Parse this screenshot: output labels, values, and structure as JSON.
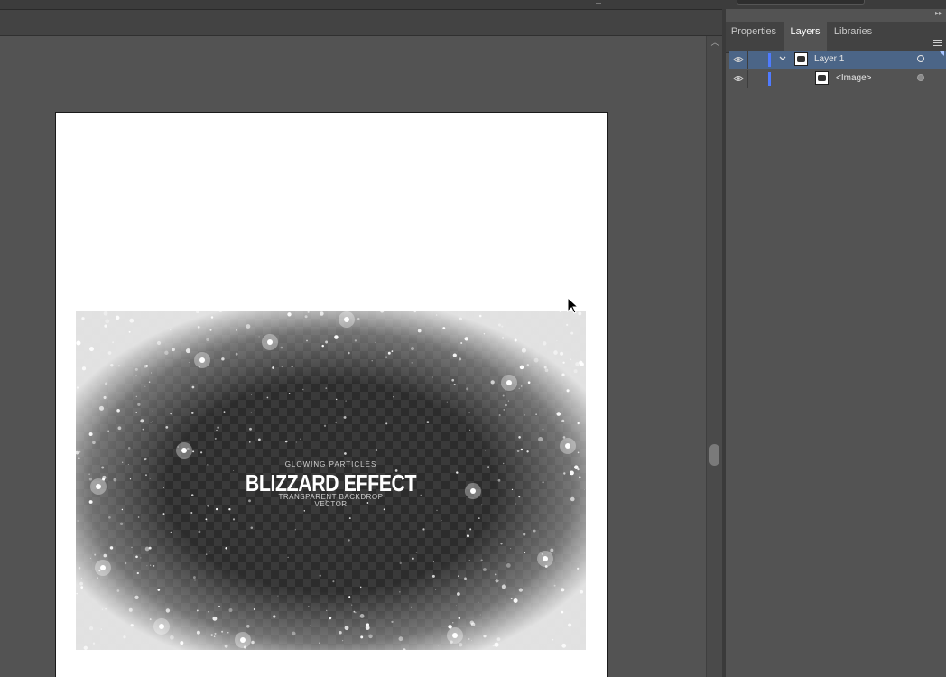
{
  "panel": {
    "tabs": [
      {
        "label": "Properties"
      },
      {
        "label": "Layers"
      },
      {
        "label": "Libraries"
      }
    ],
    "active_tab": "Layers",
    "layers": [
      {
        "name": "Layer 1",
        "expanded": true,
        "visible": true,
        "selected": true,
        "color": "#4f7bff"
      },
      {
        "name": "<Image>",
        "visible": true,
        "selected": false
      }
    ]
  },
  "artwork": {
    "subtitle": "GLOWING PARTICLES",
    "title": "BLIZZARD EFFECT",
    "caption_line1": "TRANSPARENT BACKDROP",
    "caption_line2": "VECTOR"
  },
  "colors": {
    "workspace": "#535353",
    "panel_tab_bar": "#424242",
    "selected_row": "#4b6587",
    "layer_color": "#4f7bff"
  },
  "icons": [
    "eye-icon",
    "chevron-down-icon",
    "layer-thumbnail-icon",
    "target-circle-icon",
    "panel-menu-icon",
    "cursor-arrow-icon",
    "collapse-panels-icon"
  ]
}
